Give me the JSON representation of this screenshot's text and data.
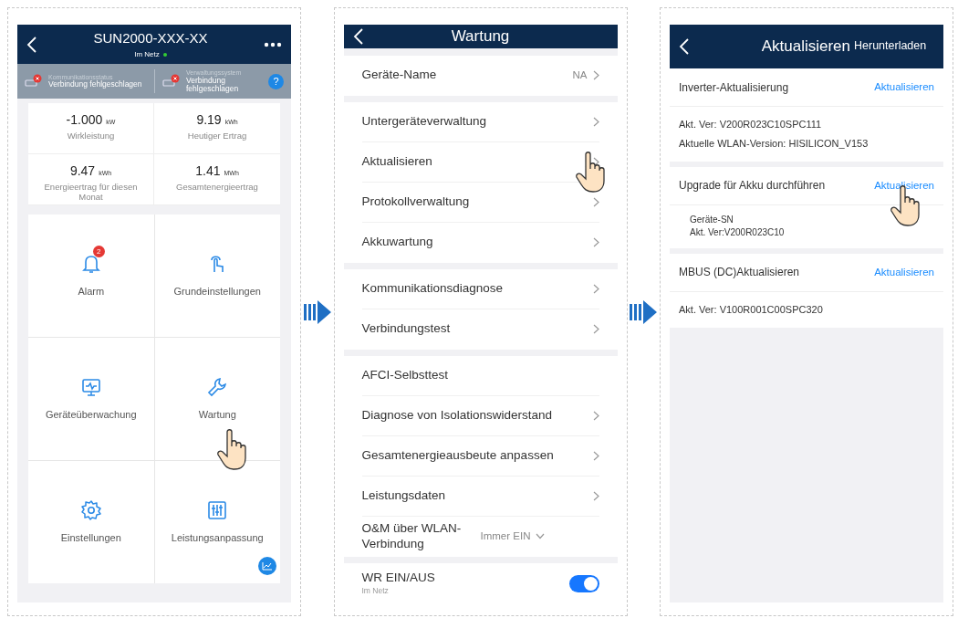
{
  "screens": [
    {
      "kind": "home",
      "title": "SUN2000-XXX-XX",
      "subtitle": "Im Netz",
      "online": true,
      "help": "?",
      "status": [
        {
          "label": "Kommunikationsstatus",
          "value": "Verbindung fehlgeschlagen",
          "error": true
        },
        {
          "label": "Verwaltungssystem",
          "value": "Verbindung fehlgeschlagen",
          "error": true
        }
      ],
      "metrics": [
        {
          "value": "-1.000",
          "unit": "kW",
          "label": "Wirkleistung"
        },
        {
          "value": "9.19",
          "unit": "kWh",
          "label": "Heutiger Ertrag"
        },
        {
          "value": "9.47",
          "unit": "kWh",
          "label": "Energieertrag für diesen Monat"
        },
        {
          "value": "1.41",
          "unit": "MWh",
          "label": "Gesamtenergieertrag"
        }
      ],
      "tiles": [
        {
          "label": "Alarm",
          "badge": "2",
          "tapped": false
        },
        {
          "label": "Grundeinstellungen",
          "tapped": false
        },
        {
          "label": "Geräteüberwachung",
          "tapped": false
        },
        {
          "label": "Wartung",
          "tapped": true
        },
        {
          "label": "Einstellungen",
          "tapped": false
        },
        {
          "label": "Leistungsanpassung",
          "tapped": false
        }
      ]
    },
    {
      "kind": "list",
      "title": "Wartung",
      "groups": [
        [
          {
            "kind": "link",
            "label": "Geräte-Name",
            "value": "NA",
            "tapped": false
          }
        ],
        [
          {
            "kind": "link",
            "label": "Untergeräteverwaltung",
            "tapped": false
          },
          {
            "kind": "link",
            "label": "Aktualisieren",
            "tapped": true
          },
          {
            "kind": "link",
            "label": "Protokollverwaltung",
            "tapped": false
          },
          {
            "kind": "link",
            "label": "Akkuwartung",
            "tapped": false
          }
        ],
        [
          {
            "kind": "link",
            "label": "Kommunikationsdiagnose",
            "tapped": false
          },
          {
            "kind": "link",
            "label": "Verbindungstest",
            "tapped": false
          }
        ],
        [
          {
            "kind": "plain",
            "label": "AFCI-Selbsttest",
            "tapped": false
          },
          {
            "kind": "link",
            "label": "Diagnose von Isolationswiderstand",
            "tapped": false
          },
          {
            "kind": "link",
            "label": "Gesamtenergieausbeute anpassen",
            "tapped": false
          },
          {
            "kind": "link",
            "label": "Leistungsdaten",
            "tapped": false
          },
          {
            "kind": "dropdown",
            "label": "O&M über WLAN-Verbindung",
            "value": "Immer EIN",
            "tapped": false
          }
        ],
        [
          {
            "kind": "toggle",
            "label": "WR EIN/AUS",
            "sublabel": "Im Netz",
            "on": true,
            "tapped": false
          }
        ]
      ]
    },
    {
      "kind": "update",
      "title": "Aktualisieren",
      "action": "Herunterladen",
      "sections": [
        {
          "title": "Inverter-Aktualisierung",
          "action": "Aktualisieren",
          "tapped": false,
          "indented": false,
          "lines": [
            "Akt. Ver: V200R023C10SPC111",
            "Aktuelle WLAN-Version: HISILICON_V153"
          ]
        },
        {
          "title": "Upgrade für Akku durchführen",
          "action": "Aktualisieren",
          "tapped": true,
          "indented": true,
          "lines": [
            "Geräte-SN",
            "Akt. Ver:V200R023C10"
          ]
        },
        {
          "title": "MBUS (DC)Aktualisieren",
          "action": "Aktualisieren",
          "tapped": false,
          "indented": false,
          "lines": [
            "Akt. Ver: V100R001C00SPC320"
          ]
        }
      ]
    }
  ]
}
